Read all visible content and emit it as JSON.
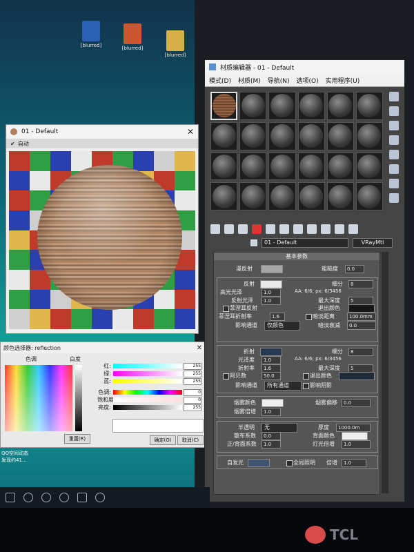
{
  "desktop": {
    "icons": [
      {
        "label": "[blurred]"
      },
      {
        "label": "[blurred]"
      },
      {
        "label": "[blurred]"
      }
    ],
    "taskbar_notice": "QQ空间动态\n发现约41..."
  },
  "preview_window": {
    "title": "01 - Default",
    "auto_label": "自动"
  },
  "color_picker": {
    "title": "颜色选择器: reflection",
    "hue_label": "色调",
    "white_label": "白度",
    "channels": [
      {
        "label": "红:",
        "value": "255"
      },
      {
        "label": "绿:",
        "value": "255"
      },
      {
        "label": "蓝:",
        "value": "255"
      },
      {
        "label": "色调:",
        "value": "0"
      },
      {
        "label": "饱和度:",
        "value": "0"
      },
      {
        "label": "亮度:",
        "value": "255"
      }
    ],
    "reset_label": "重置(R)",
    "ok_label": "确定(O)",
    "cancel_label": "取消(C)"
  },
  "material_editor": {
    "title": "材质编辑器 - 01 - Default",
    "menu": [
      "模式(D)",
      "材质(M)",
      "导航(N)",
      "选项(O)",
      "实用程序(U)"
    ],
    "material_name": "01 - Default",
    "material_type": "VRayMtl",
    "rollout_title": "基本参数",
    "diffuse": {
      "label": "漫反射",
      "roughness_label": "粗糙度",
      "roughness_value": "0.0"
    },
    "reflection": {
      "label": "反射",
      "subdivs_label": "细分",
      "subdivs_value": "8",
      "hilight_label": "高光光泽",
      "hilight_value": "1.0",
      "aa_text": "AA: 6/6; px: 6/3456",
      "gloss_label": "反射光泽",
      "gloss_value": "1.0",
      "depth_label": "最大深度",
      "depth_value": "5",
      "fresnel_label": "菲涅耳反射",
      "exit_label": "退出颜色",
      "ior_label": "菲涅耳折射率",
      "ior_value": "1.6",
      "dim_label": "暗淡距离",
      "dim_value": "100.0mm",
      "affect_label": "影响通道",
      "affect_value": "仅颜色",
      "falloff_label": "暗淡衰减",
      "falloff_value": "0.0"
    },
    "refraction": {
      "label": "折射",
      "subdivs_label": "细分",
      "subdivs_value": "8",
      "gloss_label": "光泽度",
      "gloss_value": "1.0",
      "aa_text": "AA: 6/6; px: 6/3456",
      "ior_label": "折射率",
      "ior_value": "1.6",
      "depth_label": "最大深度",
      "depth_value": "5",
      "abbe_label": "阿贝数",
      "abbe_value": "50.0",
      "exit_label": "退出颜色",
      "affect_label": "影响通道",
      "affect_value": "所有通道",
      "shadow_label": "影响阴影"
    },
    "fog": {
      "color_label": "烟雾颜色",
      "multiplier_label": "烟雾倍增",
      "multiplier_value": "1.0",
      "bias_label": "烟雾偏移",
      "bias_value": "0.0"
    },
    "translucency": {
      "label": "半透明",
      "value": "无",
      "scatter_label": "散布系数",
      "scatter_value": "0.0",
      "fwd_label": "正/背面系数",
      "fwd_value": "1.0",
      "thickness_label": "厚度",
      "thickness_value": "1000.0m",
      "back_label": "背面颜色",
      "light_label": "灯光倍增",
      "light_value": "1.0"
    },
    "self_illum": {
      "label": "自发光",
      "gi_label": "全局照明",
      "mult_label": "倍增",
      "mult_value": "1.0"
    }
  },
  "colors": {
    "desktop_teal": "#15a39a",
    "editor_bg": "#444444",
    "refraction_swatch": "#26394f"
  },
  "bezel_brand": "TCL"
}
